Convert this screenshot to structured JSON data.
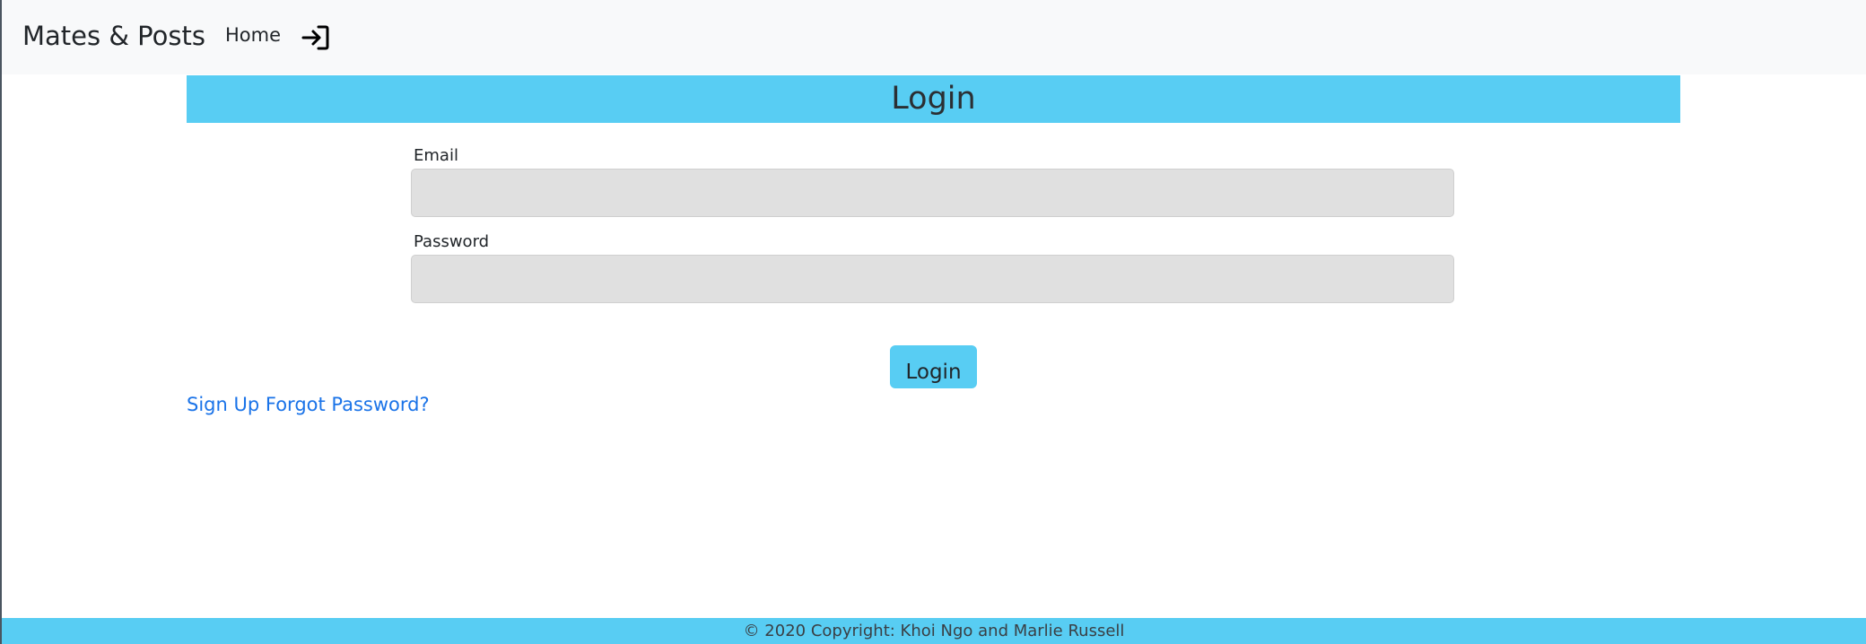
{
  "navbar": {
    "brand": "Mates & Posts",
    "home_label": "Home",
    "login_icon": "sign-in-icon"
  },
  "login": {
    "title": "Login",
    "email_label": "Email",
    "email_value": "",
    "password_label": "Password",
    "password_value": "",
    "submit_label": "Login"
  },
  "links": {
    "signup": "Sign Up",
    "forgot": "Forgot Password?"
  },
  "footer": {
    "text": "© 2020 Copyright: Khoi Ngo and Marlie Russell"
  },
  "colors": {
    "accent": "#58cdf3",
    "navbar_bg": "#f8f9fa",
    "link": "#1a73e8",
    "input_bg": "#e0e0e0"
  }
}
